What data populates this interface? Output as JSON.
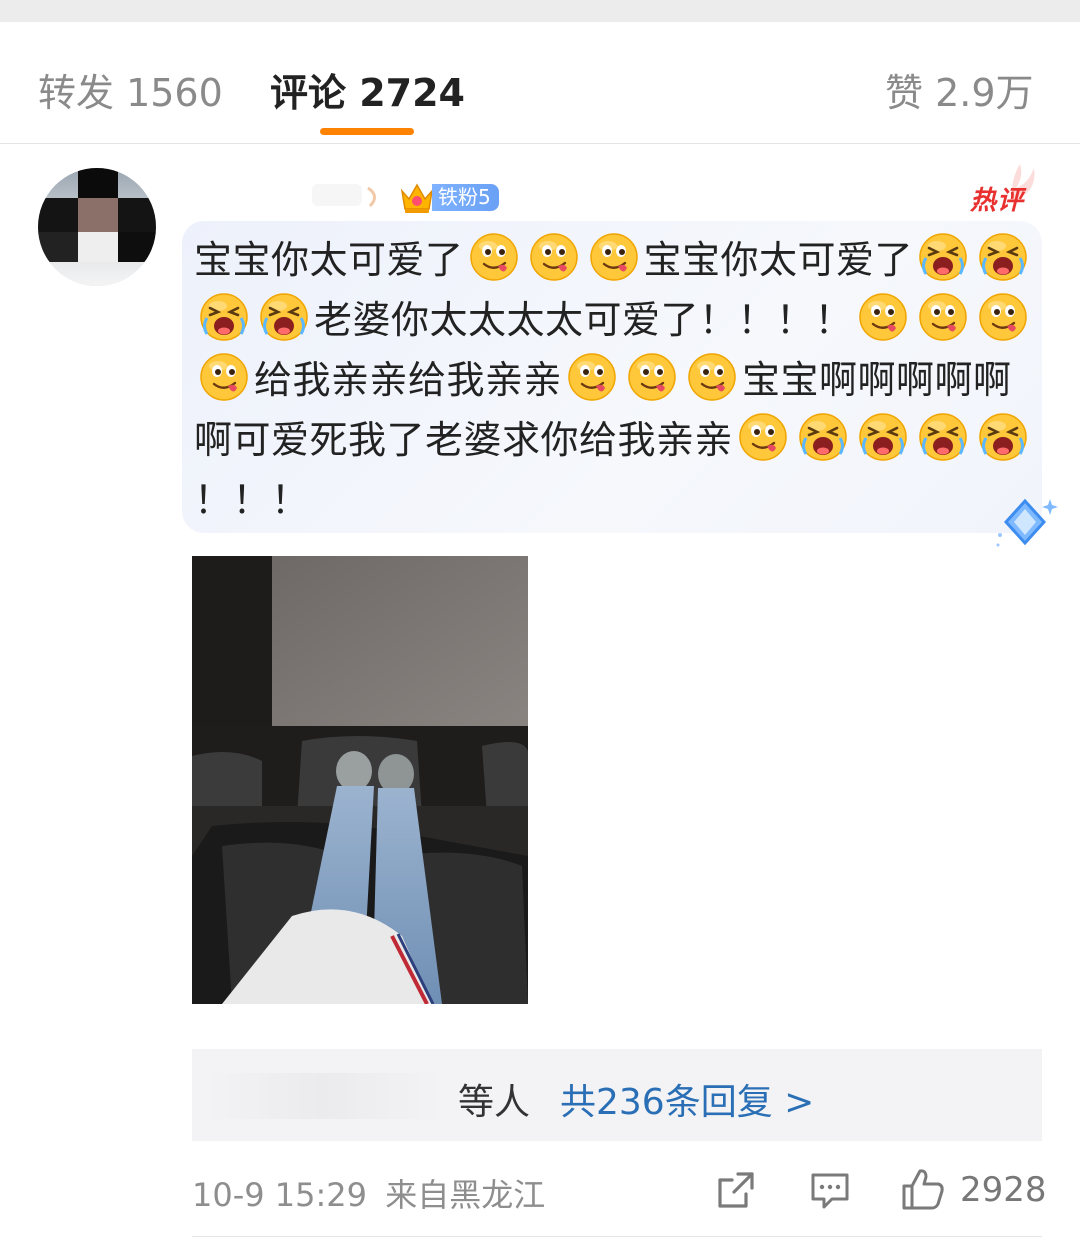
{
  "tabs": {
    "repost": "转发 1560",
    "comments": "评论 2724",
    "likes": "赞 2.9万"
  },
  "comment": {
    "fan_badge": "铁粉5",
    "hot_label": "热评",
    "segments": [
      {
        "t": "text",
        "v": "宝宝你太可爱了"
      },
      {
        "t": "emoji",
        "v": "tongue"
      },
      {
        "t": "emoji",
        "v": "tongue"
      },
      {
        "t": "emoji",
        "v": "tongue"
      },
      {
        "t": "text",
        "v": "宝宝你太可爱了"
      },
      {
        "t": "emoji",
        "v": "cry"
      },
      {
        "t": "emoji",
        "v": "cry"
      },
      {
        "t": "emoji",
        "v": "cry"
      },
      {
        "t": "emoji",
        "v": "cry"
      },
      {
        "t": "text",
        "v": "老婆你太太太太可爱了！！！！"
      },
      {
        "t": "emoji",
        "v": "tongue"
      },
      {
        "t": "emoji",
        "v": "tongue"
      },
      {
        "t": "emoji",
        "v": "tongue"
      },
      {
        "t": "emoji",
        "v": "tongue"
      },
      {
        "t": "text",
        "v": "给我亲亲给我亲亲"
      },
      {
        "t": "emoji",
        "v": "tongue"
      },
      {
        "t": "emoji",
        "v": "tongue"
      },
      {
        "t": "emoji",
        "v": "tongue"
      },
      {
        "t": "text",
        "v": "宝宝啊啊啊啊啊啊可爱死我了老婆求你给我亲亲"
      },
      {
        "t": "emoji",
        "v": "tongue"
      },
      {
        "t": "emoji",
        "v": "cry"
      },
      {
        "t": "emoji",
        "v": "cry"
      },
      {
        "t": "emoji",
        "v": "cry"
      },
      {
        "t": "emoji",
        "v": "cry"
      },
      {
        "t": "text",
        "v": "！！！"
      }
    ]
  },
  "replies": {
    "suffix": "等人",
    "link": "共236条回复 >"
  },
  "meta": {
    "time": "10-9 15:29",
    "location": "来自黑龙江",
    "like_count": "2928"
  },
  "colors": {
    "accent": "#ff8200",
    "link": "#2a6fb5",
    "hot": "#e8302f"
  },
  "icons": {
    "share": "share-icon",
    "comment": "comment-icon",
    "like": "thumbs-up-icon"
  }
}
